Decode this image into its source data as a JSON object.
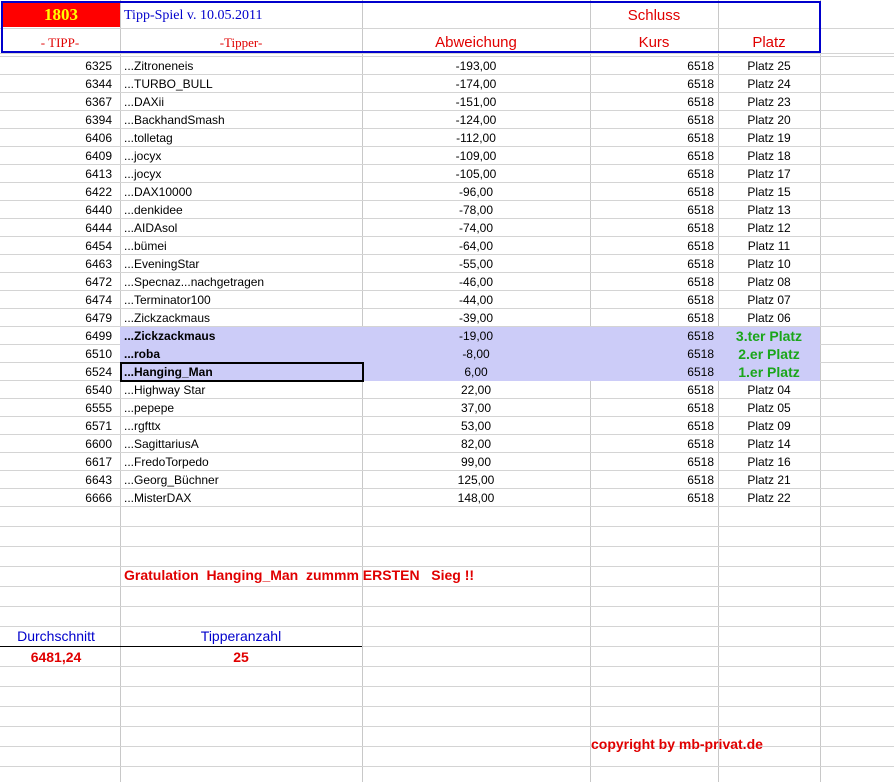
{
  "header": {
    "number": "1803",
    "title": "Tipp-Spiel v. 10.05.2011",
    "schluss": "Schluss",
    "col_tipp": "- TIPP-",
    "col_tipper": "-Tipper-",
    "col_abweichung": "Abweichung",
    "col_kurs": "Kurs",
    "col_platz": "Platz"
  },
  "rows": [
    {
      "tipp": "6325",
      "tipper": "...Zitroneneis",
      "abw": "-193,00",
      "kurs": "6518",
      "platz": "Platz 25"
    },
    {
      "tipp": "6344",
      "tipper": "...TURBO_BULL",
      "abw": "-174,00",
      "kurs": "6518",
      "platz": "Platz 24"
    },
    {
      "tipp": "6367",
      "tipper": "...DAXii",
      "abw": "-151,00",
      "kurs": "6518",
      "platz": "Platz 23"
    },
    {
      "tipp": "6394",
      "tipper": "...BackhandSmash",
      "abw": "-124,00",
      "kurs": "6518",
      "platz": "Platz 20"
    },
    {
      "tipp": "6406",
      "tipper": "...tolletag",
      "abw": "-112,00",
      "kurs": "6518",
      "platz": "Platz 19"
    },
    {
      "tipp": "6409",
      "tipper": "...jocyx",
      "abw": "-109,00",
      "kurs": "6518",
      "platz": "Platz 18"
    },
    {
      "tipp": "6413",
      "tipper": "...jocyx",
      "abw": "-105,00",
      "kurs": "6518",
      "platz": "Platz 17"
    },
    {
      "tipp": "6422",
      "tipper": "...DAX10000",
      "abw": "-96,00",
      "kurs": "6518",
      "platz": "Platz 15"
    },
    {
      "tipp": "6440",
      "tipper": "...denkidee",
      "abw": "-78,00",
      "kurs": "6518",
      "platz": "Platz 13"
    },
    {
      "tipp": "6444",
      "tipper": "...AIDAsol",
      "abw": "-74,00",
      "kurs": "6518",
      "platz": "Platz 12"
    },
    {
      "tipp": "6454",
      "tipper": "...bümei",
      "abw": "-64,00",
      "kurs": "6518",
      "platz": "Platz 11"
    },
    {
      "tipp": "6463",
      "tipper": "...EveningStar",
      "abw": "-55,00",
      "kurs": "6518",
      "platz": "Platz 10"
    },
    {
      "tipp": "6472",
      "tipper": "...Specnaz...nachgetragen",
      "abw": "-46,00",
      "kurs": "6518",
      "platz": "Platz 08"
    },
    {
      "tipp": "6474",
      "tipper": "...Terminator100",
      "abw": "-44,00",
      "kurs": "6518",
      "platz": "Platz 07"
    },
    {
      "tipp": "6479",
      "tipper": "...Zickzackmaus",
      "abw": "-39,00",
      "kurs": "6518",
      "platz": "Platz 06"
    },
    {
      "tipp": "6499",
      "tipper": "...Zickzackmaus",
      "abw": "-19,00",
      "kurs": "6518",
      "platz": "3.ter Platz",
      "winner": true
    },
    {
      "tipp": "6510",
      "tipper": "...roba",
      "abw": "-8,00",
      "kurs": "6518",
      "platz": "2.er Platz",
      "winner": true
    },
    {
      "tipp": "6524",
      "tipper": "...Hanging_Man",
      "abw": "6,00",
      "kurs": "6518",
      "platz": "1.er Platz",
      "winner": true,
      "selected": true
    },
    {
      "tipp": "6540",
      "tipper": "...Highway Star",
      "abw": "22,00",
      "kurs": "6518",
      "platz": "Platz 04"
    },
    {
      "tipp": "6555",
      "tipper": "...pepepe",
      "abw": "37,00",
      "kurs": "6518",
      "platz": "Platz 05"
    },
    {
      "tipp": "6571",
      "tipper": "...rgfttx",
      "abw": "53,00",
      "kurs": "6518",
      "platz": "Platz 09"
    },
    {
      "tipp": "6600",
      "tipper": "...SagittariusA",
      "abw": "82,00",
      "kurs": "6518",
      "platz": "Platz 14"
    },
    {
      "tipp": "6617",
      "tipper": "...FredoTorpedo",
      "abw": "99,00",
      "kurs": "6518",
      "platz": "Platz 16"
    },
    {
      "tipp": "6643",
      "tipper": "...Georg_Büchner",
      "abw": "125,00",
      "kurs": "6518",
      "platz": "Platz 21"
    },
    {
      "tipp": "6666",
      "tipper": "...MisterDAX",
      "abw": "148,00",
      "kurs": "6518",
      "platz": "Platz 22"
    }
  ],
  "footer": {
    "gratulation": "Gratulation  Hanging_Man  zummm ERSTEN   Sieg !!",
    "durchschnitt_label": "Durchschnitt",
    "durchschnitt_value": "6481,24",
    "tipperanzahl_label": "Tipperanzahl",
    "tipperanzahl_value": "25",
    "copyright": "copyright by mb-privat.de"
  },
  "colors": {
    "accent_red": "#ff0000",
    "header_blue": "#0000cc",
    "highlight": "#ccccf8",
    "winner_green": "#1aa61a"
  }
}
